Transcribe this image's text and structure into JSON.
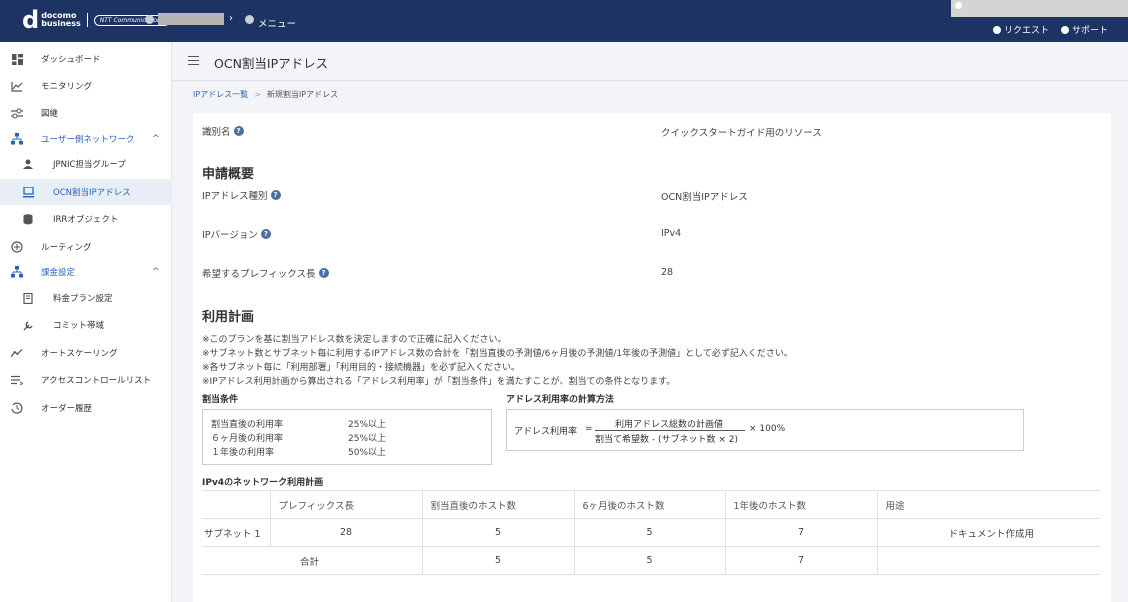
{
  "header": {
    "brand_top": "docomo",
    "brand_bottom": "business",
    "partner": "NTT Communications",
    "menu_label": "メニュー",
    "request_label": "リクエスト",
    "support_label": "サポート"
  },
  "sidebar": {
    "items": [
      {
        "label": "ダッシュボード",
        "icon": "dashboard-icon"
      },
      {
        "label": "モニタリング",
        "icon": "chart-line-icon"
      },
      {
        "label": "図継",
        "icon": "settings-sliders-icon"
      },
      {
        "label": "ユーザー側ネットワーク",
        "icon": "network-icon"
      },
      {
        "label": "JPNIC担当グループ",
        "icon": "person-icon"
      },
      {
        "label": "OCN割当IPアドレス",
        "icon": "monitor-icon"
      },
      {
        "label": "IRRオブジェクト",
        "icon": "database-icon"
      },
      {
        "label": "ルーティング",
        "icon": "routing-icon"
      },
      {
        "label": "課金設定",
        "icon": "network-icon"
      },
      {
        "label": "料金プラン設定",
        "icon": "document-icon"
      },
      {
        "label": "コミット帯域",
        "icon": "wrench-icon"
      },
      {
        "label": "オートスケーリング",
        "icon": "autoscale-icon"
      },
      {
        "label": "アクセスコントロールリスト",
        "icon": "list-icon"
      },
      {
        "label": "オーダー履歴",
        "icon": "history-icon"
      }
    ]
  },
  "page": {
    "title": "OCN割当IPアドレス",
    "breadcrumb_link": "IPアドレス一覧",
    "breadcrumb_sep": ">",
    "breadcrumb_current": "新規割当IPアドレス"
  },
  "form": {
    "id_label": "識別名",
    "id_value": "クイックスタートガイド用のリソース",
    "summary_title": "申請概要",
    "type_label": "IPアドレス種別",
    "type_value": "OCN割当IPアドレス",
    "version_label": "IPバージョン",
    "version_value": "IPv4",
    "prefix_label": "希望するプレフィックス長",
    "prefix_value": "28"
  },
  "plan": {
    "title": "利用計画",
    "notes": [
      "※このプランを基に割当アドレス数を決定しますので正確に記入ください。",
      "※サブネット数とサブネット毎に利用するIPアドレス数の合計を「割当直後の予測値/6ヶ月後の予測値/1年後の予測値」として必ず記入ください。",
      "※各サブネット毎に「利用部署」「利用目的・接続機器」を必ず記入ください。",
      "※IPアドレス利用計画から算出される「アドレス利用率」が「割当条件」を満たすことが、割当ての条件となります。"
    ],
    "conditions_title": "割当条件",
    "conditions": [
      {
        "label": "割当直後の利用率",
        "value": "25%以上"
      },
      {
        "label": "６ヶ月後の利用率",
        "value": "25%以上"
      },
      {
        "label": "１年後の利用率",
        "value": "50%以上"
      }
    ],
    "formula_title": "アドレス利用率の計算方法",
    "formula_lhs": "アドレス利用率",
    "formula_eq": "=",
    "formula_numerator": "利用アドレス総数の計画値",
    "formula_denominator": "割当て希望数 - (サブネット数 × 2)",
    "formula_multiplier": "× 100%"
  },
  "network_table": {
    "title": "IPv4のネットワーク利用計画",
    "headers": [
      "プレフィックス長",
      "割当直後のホスト数",
      "6ヶ月後のホスト数",
      "1年後のホスト数",
      "用途"
    ],
    "rows": [
      {
        "name": "サブネット 1",
        "prefix": "28",
        "immediate": "5",
        "six_months": "5",
        "one_year": "7",
        "purpose": "ドキュメント作成用"
      }
    ],
    "total": {
      "name": "合計",
      "immediate": "5",
      "six_months": "5",
      "one_year": "7"
    }
  }
}
